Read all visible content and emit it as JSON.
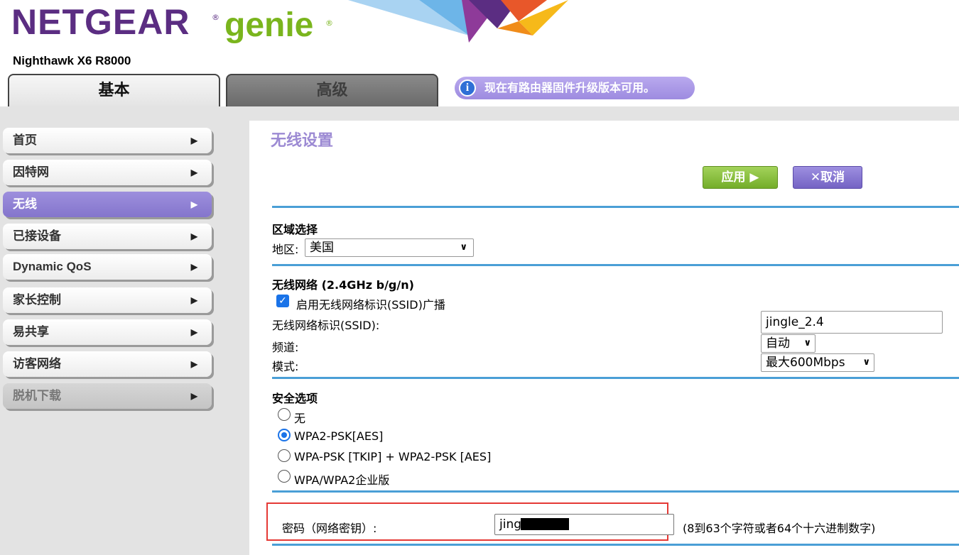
{
  "header": {
    "logo_brand": "NETGEAR",
    "logo_product": "genie",
    "registered_mark": "®",
    "model": "Nighthawk X6 R8000",
    "tabs": [
      {
        "label": "基本",
        "active": true
      },
      {
        "label": "高级",
        "active": false
      }
    ],
    "notice": {
      "icon": "info-icon",
      "text": "现在有路由器固件升级版本可用。"
    }
  },
  "sidebar": {
    "items": [
      {
        "label": "首页",
        "state": "normal"
      },
      {
        "label": "因特网",
        "state": "normal"
      },
      {
        "label": "无线",
        "state": "active"
      },
      {
        "label": "已接设备",
        "state": "normal"
      },
      {
        "label": "Dynamic QoS",
        "state": "normal"
      },
      {
        "label": "家长控制",
        "state": "normal"
      },
      {
        "label": "易共享",
        "state": "normal"
      },
      {
        "label": "访客网络",
        "state": "normal"
      },
      {
        "label": "脱机下载",
        "state": "disabled"
      }
    ],
    "arrow": "▶"
  },
  "main": {
    "title": "无线设置",
    "apply_label": "应用 ▶",
    "cancel_label": "✕取消",
    "region": {
      "title": "区域选择",
      "label": "地区:",
      "value": "美国"
    },
    "wireless": {
      "title": "无线网络 (2.4GHz b/g/n)",
      "ssid_broadcast_label": "启用无线网络标识(SSID)广播",
      "ssid_broadcast_checked": true,
      "ssid_label": "无线网络标识(SSID):",
      "ssid_value": "jingle_2.4",
      "channel_label": "频道:",
      "channel_value": "自动",
      "mode_label": "模式:",
      "mode_value": "最大600Mbps"
    },
    "security": {
      "title": "安全选项",
      "options": [
        {
          "label": "无",
          "selected": false
        },
        {
          "label": "WPA2-PSK[AES]",
          "selected": true
        },
        {
          "label": "WPA-PSK [TKIP] + WPA2-PSK [AES]",
          "selected": false
        },
        {
          "label": "WPA/WPA2企业版",
          "selected": false
        }
      ]
    },
    "password": {
      "label": "密码（网络密钥）:",
      "value": "jing",
      "hint": "(8到63个字符或者64个十六进制数字)"
    }
  },
  "colors": {
    "brand_purple": "#5b2d82",
    "brand_green": "#7ab51d",
    "accent_purple": "#8475cc",
    "separator_blue": "#4a9fd6",
    "highlight_red": "#e53935"
  }
}
